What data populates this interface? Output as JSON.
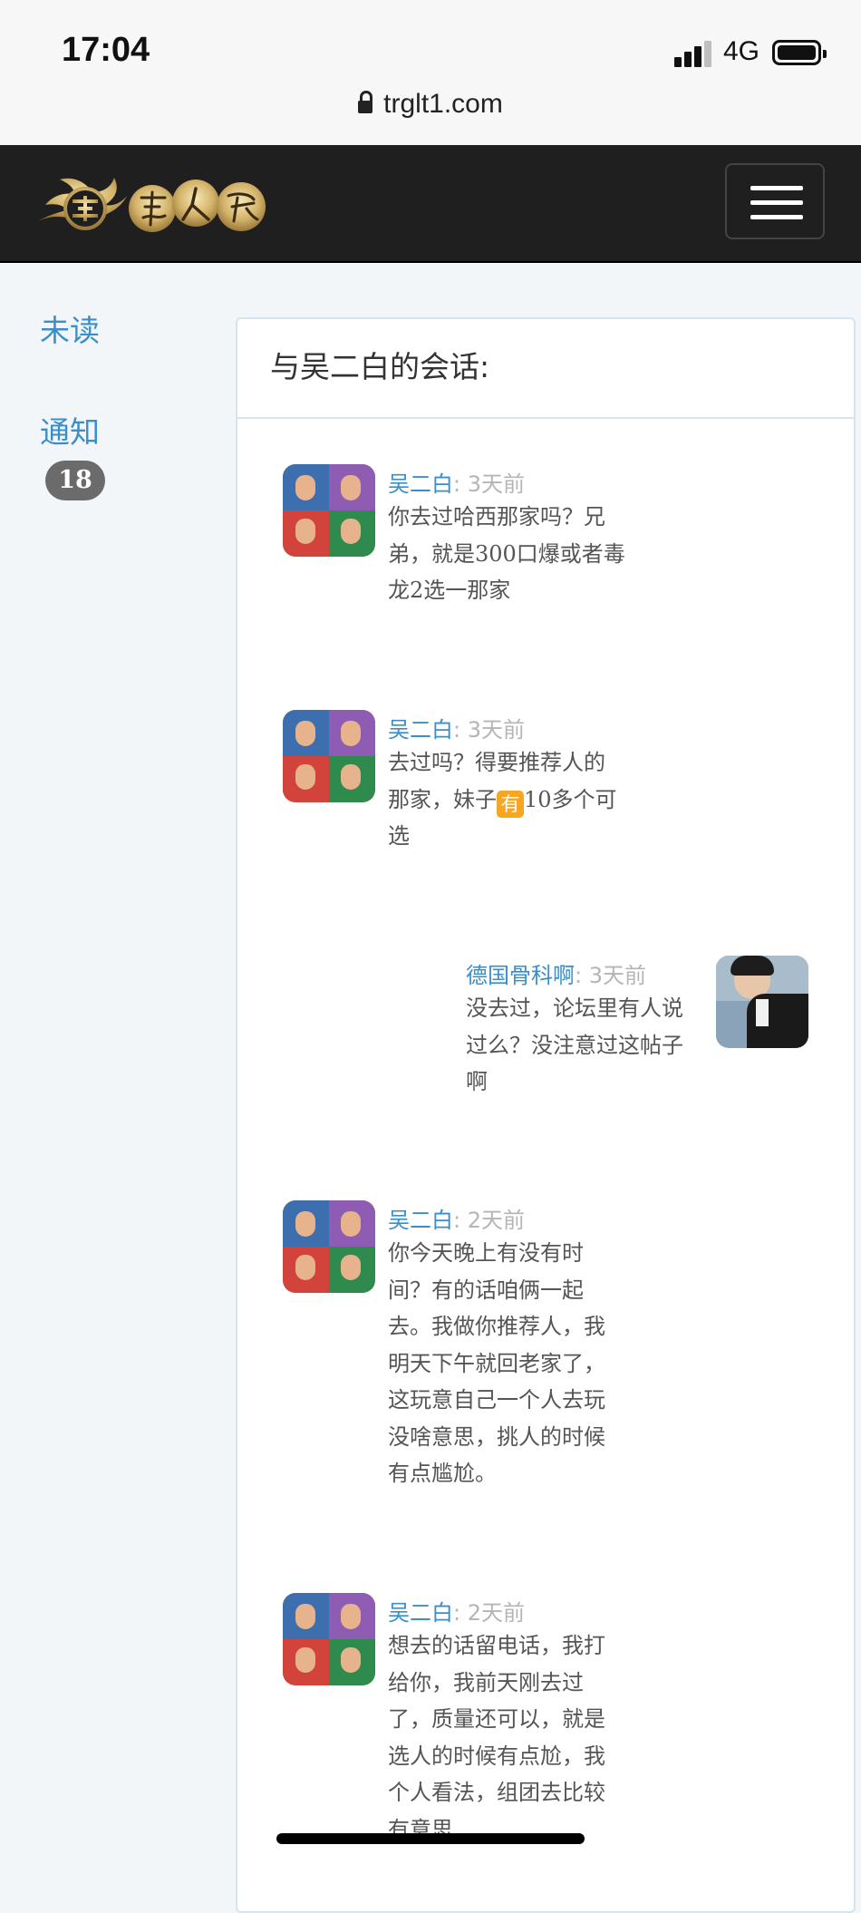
{
  "status_bar": {
    "time": "17:04",
    "network": "4G",
    "url": "trglt1.com"
  },
  "sidebar": {
    "unread_label": "未读",
    "notifications_label": "通知",
    "notifications_count": "18"
  },
  "conversation": {
    "title": "与吴二白的会话:",
    "messages": [
      {
        "sender": "吴二白",
        "sep": ":",
        "time": "3天前",
        "text": "你去过哈西那家吗？兄弟，就是300口爆或者毒龙2选一那家"
      },
      {
        "sender": "吴二白",
        "sep": ":",
        "time": "3天前",
        "text_before": "去过吗？得要推荐人的那家，妹子",
        "badge": "有",
        "text_after": "10多个可选"
      },
      {
        "sender": "德国骨科啊",
        "sep": ":",
        "time": "3天前",
        "text": "没去过，论坛里有人说过么？没注意过这帖子啊"
      },
      {
        "sender": "吴二白",
        "sep": ":",
        "time": "2天前",
        "text": "你今天晚上有没有时间？有的话咱俩一起去。我做你推荐人，我明天下午就回老家了，这玩意自己一个人去玩没啥意思，挑人的时候有点尴尬。"
      },
      {
        "sender": "吴二白",
        "sep": ":",
        "time": "2天前",
        "text": "想去的话留电话，我打给你，我前天刚去过了，质量还可以，就是选人的时候有点尬，我个人看法，组团去比较有意思"
      }
    ]
  },
  "colors": {
    "link": "#3a8fc8",
    "header_bg": "#1f1f1f",
    "page_bg": "#f2f6f9",
    "badge_bg": "#6b6b6b"
  }
}
